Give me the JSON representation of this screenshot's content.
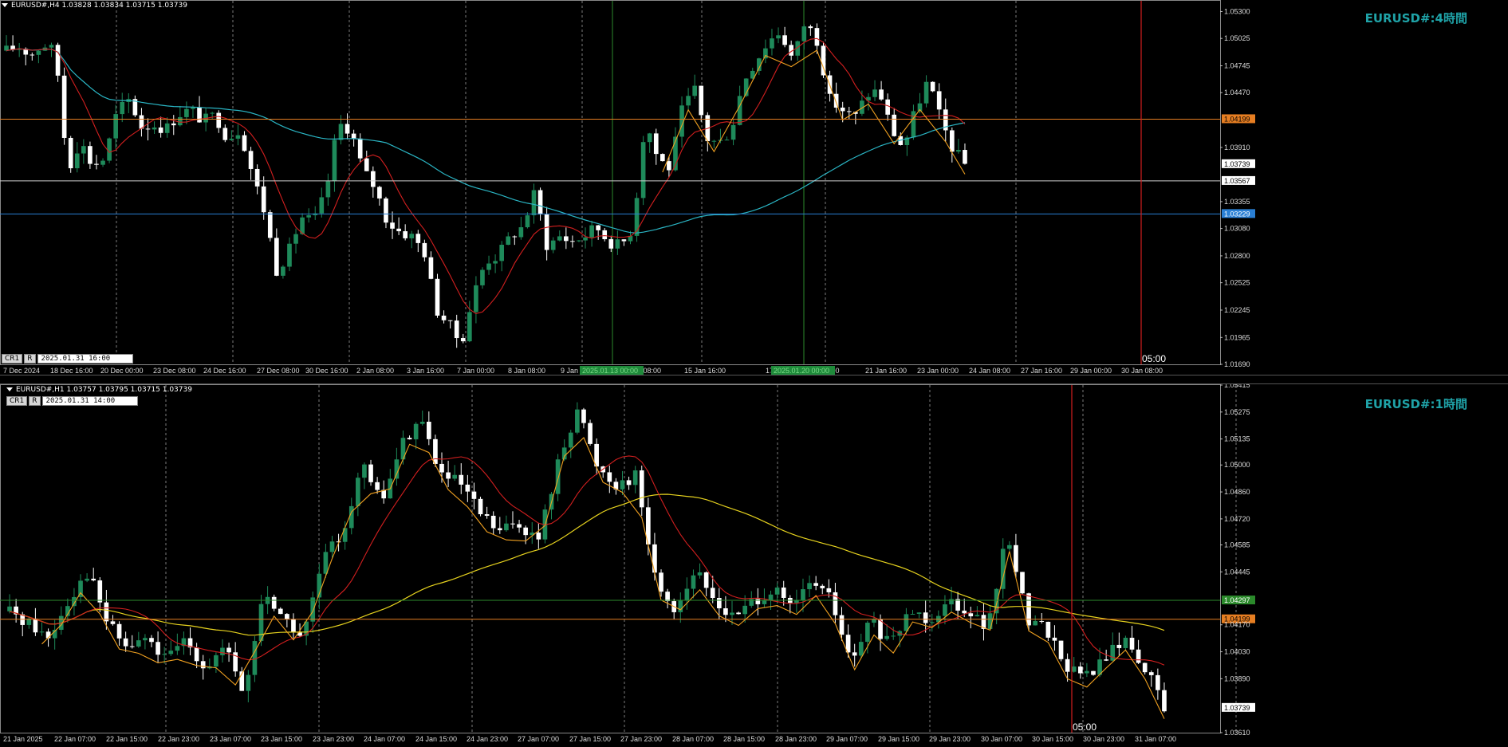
{
  "top": {
    "header": "EURUSD#,H4  1.03828 1.03834 1.03715 1.03739",
    "title": "EURUSD#:4時間",
    "cr": "CR1",
    "r": "R",
    "crosshair_time": "2025.01.31 16:00",
    "vline_label": "05:00",
    "price_labels": [
      "1.05300",
      "1.05025",
      "1.04745",
      "1.04470",
      "1.04199",
      "1.03910",
      "1.03739",
      "1.03567",
      "1.03355",
      "1.03229",
      "1.03080",
      "1.02800",
      "1.02525",
      "1.02245",
      "1.01965",
      "1.01690"
    ],
    "time_labels": [
      "7 Dec 2024",
      "18 Dec 16:00",
      "20 Dec 00:00",
      "23 Dec 08:00",
      "24 Dec 16:00",
      "27 Dec 08:00",
      "30 Dec 16:00",
      "2 Jan 08:00",
      "3 Jan 16:00",
      "7 Jan 00:00",
      "8 Jan 08:00",
      "9 Jan",
      "14 Jan 08:00",
      "15 Jan 16:00",
      "17",
      "08:00",
      "21 Jan 16:00",
      "23 Jan 00:00",
      "24 Jan 08:00",
      "27 Jan 16:00",
      "29 Jan 00:00",
      "30 Jan 08:00"
    ],
    "green_tags": [
      "2025.01.13 00:00",
      "2025.01.20 00:00"
    ],
    "highlight_prices": {
      "orange": "1.04199",
      "white": "1.03567",
      "blue": "1.03229",
      "current": "1.03739"
    }
  },
  "bottom": {
    "header": "EURUSD#,H1  1.03757 1.03795 1.03715 1.03739",
    "title": "EURUSD#:1時間",
    "cr": "CR1",
    "r": "R",
    "crosshair_time": "2025.01.31 14:00",
    "vline_label": "05:00",
    "price_labels": [
      "1.05415",
      "1.05275",
      "1.05135",
      "1.05000",
      "1.04860",
      "1.04720",
      "1.04585",
      "1.04445",
      "1.04297",
      "1.04199",
      "1.04170",
      "1.04030",
      "1.03890",
      "1.03739",
      "1.03610"
    ],
    "time_labels": [
      "21 Jan 2025",
      "22 Jan 07:00",
      "22 Jan 15:00",
      "22 Jan 23:00",
      "23 Jan 07:00",
      "23 Jan 15:00",
      "23 Jan 23:00",
      "24 Jan 07:00",
      "24 Jan 15:00",
      "24 Jan 23:00",
      "27 Jan 07:00",
      "27 Jan 15:00",
      "27 Jan 23:00",
      "28 Jan 07:00",
      "28 Jan 15:00",
      "28 Jan 23:00",
      "29 Jan 07:00",
      "29 Jan 15:00",
      "29 Jan 23:00",
      "30 Jan 07:00",
      "30 Jan 15:00",
      "30 Jan 23:00",
      "31 Jan 07:00"
    ],
    "highlight_prices": {
      "green": "1.04297",
      "orange": "1.04199",
      "current": "1.03739"
    }
  },
  "colors": {
    "bull": "#1e8a5a",
    "bear": "#ffffff",
    "ma_fast": "#d21f1f",
    "ma_slow_top": "#2ab5c4",
    "ma_slow_bottom": "#e6d21e",
    "zigzag": "#f0a020",
    "orange_line": "#e67e22",
    "blue_line": "#2a7fd4",
    "green_line": "#2b8a2b",
    "red_vline": "#d21f1f"
  },
  "chart_data": [
    {
      "type": "candlestick",
      "title": "EURUSD#:4時間",
      "timeframe": "H4",
      "ylim": [
        1.0169,
        1.0541
      ],
      "horizontal_lines": [
        1.04199,
        1.03567,
        1.03229
      ],
      "path_keypoints": [
        1.049,
        1.0494,
        1.0486,
        1.0497,
        1.0488,
        1.0368,
        1.0398,
        1.0372,
        1.038,
        1.0427,
        1.044,
        1.0412,
        1.0414,
        1.041,
        1.0425,
        1.043,
        1.0418,
        1.0424,
        1.04,
        1.041,
        1.0365,
        1.0325,
        1.0265,
        1.0285,
        1.032,
        1.0315,
        1.0345,
        1.0415,
        1.041,
        1.0368,
        1.035,
        1.0315,
        1.0305,
        1.03,
        1.0285,
        1.0225,
        1.021,
        1.019,
        1.024,
        1.0275,
        1.028,
        1.03,
        1.031,
        1.0345,
        1.029,
        1.03,
        1.0295,
        1.03,
        1.031,
        1.0295,
        1.029,
        1.031,
        1.042,
        1.038,
        1.037,
        1.043,
        1.045,
        1.04,
        1.0395,
        1.041,
        1.046,
        1.048,
        1.05,
        1.051,
        1.048,
        1.052,
        1.05,
        1.044,
        1.043,
        1.042,
        1.0445,
        1.045,
        1.041,
        1.039,
        1.043,
        1.046,
        1.042,
        1.039,
        1.0374
      ]
    },
    {
      "type": "candlestick",
      "title": "EURUSD#:1時間",
      "timeframe": "H1",
      "ylim": [
        1.0361,
        1.05415
      ],
      "horizontal_lines": [
        1.04297,
        1.04199
      ],
      "path_keypoints": [
        1.0424,
        1.0418,
        1.041,
        1.043,
        1.0445,
        1.0418,
        1.0405,
        1.041,
        1.0398,
        1.041,
        1.0395,
        1.0405,
        1.038,
        1.0435,
        1.042,
        1.041,
        1.045,
        1.0465,
        1.05,
        1.048,
        1.051,
        1.0525,
        1.0495,
        1.049,
        1.0475,
        1.0465,
        1.047,
        1.046,
        1.05,
        1.053,
        1.05,
        1.049,
        1.0495,
        1.044,
        1.0425,
        1.0445,
        1.043,
        1.042,
        1.043,
        1.0435,
        1.0425,
        1.044,
        1.043,
        1.0395,
        1.042,
        1.0405,
        1.0425,
        1.042,
        1.043,
        1.0425,
        1.0415,
        1.0465,
        1.042,
        1.0415,
        1.0395,
        1.039,
        1.04,
        1.041,
        1.0395,
        1.0374
      ]
    }
  ]
}
